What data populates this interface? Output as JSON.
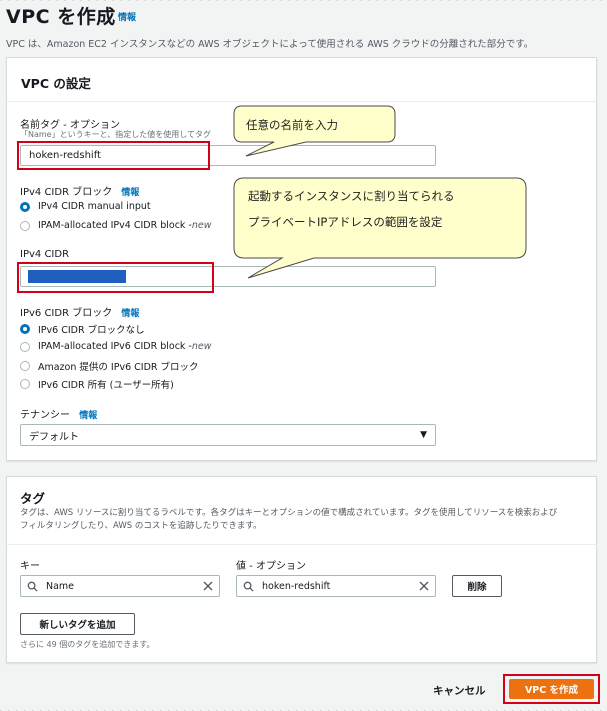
{
  "header": {
    "title": "VPC を作成",
    "info_link": "情報",
    "description": "VPC は、Amazon EC2 インスタンスなどの AWS オブジェクトによって使用される AWS クラウドの分離された部分です。"
  },
  "vpc_settings": {
    "heading": "VPC の設定",
    "name_tag": {
      "label": "名前タグ - オプション",
      "hint": "「Name」というキーと、指定した値を使用してタグ",
      "value": "hoken-redshift"
    },
    "ipv4_cidr_block": {
      "label": "IPv4 CIDR ブロック",
      "info_link": "情報",
      "options": [
        {
          "label": "IPv4 CIDR manual input",
          "badge": "",
          "selected": true
        },
        {
          "label": "IPAM-allocated IPv4 CIDR block - ",
          "badge": "new",
          "selected": false
        }
      ]
    },
    "ipv4_cidr": {
      "label": "IPv4 CIDR",
      "value": ""
    },
    "ipv6_cidr_block": {
      "label": "IPv6 CIDR ブロック",
      "info_link": "情報",
      "options": [
        {
          "label": "IPv6 CIDR ブロックなし",
          "badge": "",
          "selected": true
        },
        {
          "label": "IPAM-allocated IPv6 CIDR block - ",
          "badge": "new",
          "selected": false
        },
        {
          "label": "Amazon 提供の IPv6 CIDR ブロック",
          "badge": "",
          "selected": false
        },
        {
          "label": "IPv6 CIDR 所有 (ユーザー所有)",
          "badge": "",
          "selected": false
        }
      ]
    },
    "tenancy": {
      "label": "テナンシー",
      "info_link": "情報",
      "value": "デフォルト"
    }
  },
  "callouts": {
    "name": "任意の名前を入力",
    "cidr_line1": "起動するインスタンスに割り当てられる",
    "cidr_line2": "プライベートIPアドレスの範囲を設定"
  },
  "tags": {
    "heading": "タグ",
    "description_line1": "タグは、AWS リソースに割り当てるラベルです。各タグはキーとオプションの値で構成されています。タグを使用してリソースを検索および",
    "description_line2": "フィルタリングしたり、AWS のコストを追跡したりできます。",
    "key_label": "キー",
    "value_label": "値 - オプション",
    "rows": [
      {
        "key": "Name",
        "value": "hoken-redshift",
        "remove_label": "削除"
      }
    ],
    "add_button": "新しいタグを追加",
    "remaining_note": "さらに 49 個のタグを追加できます。"
  },
  "footer": {
    "cancel": "キャンセル",
    "create": "VPC を作成"
  },
  "colors": {
    "primary_button": "#ec7211",
    "highlight_border": "#d3001a",
    "callout_fill": "#ffffcc",
    "link": "#0073bb",
    "redacted_bar": "#1f5fc0"
  },
  "icons": {
    "search": "search-icon",
    "clear": "close-icon",
    "dropdown": "caret-down-icon"
  }
}
